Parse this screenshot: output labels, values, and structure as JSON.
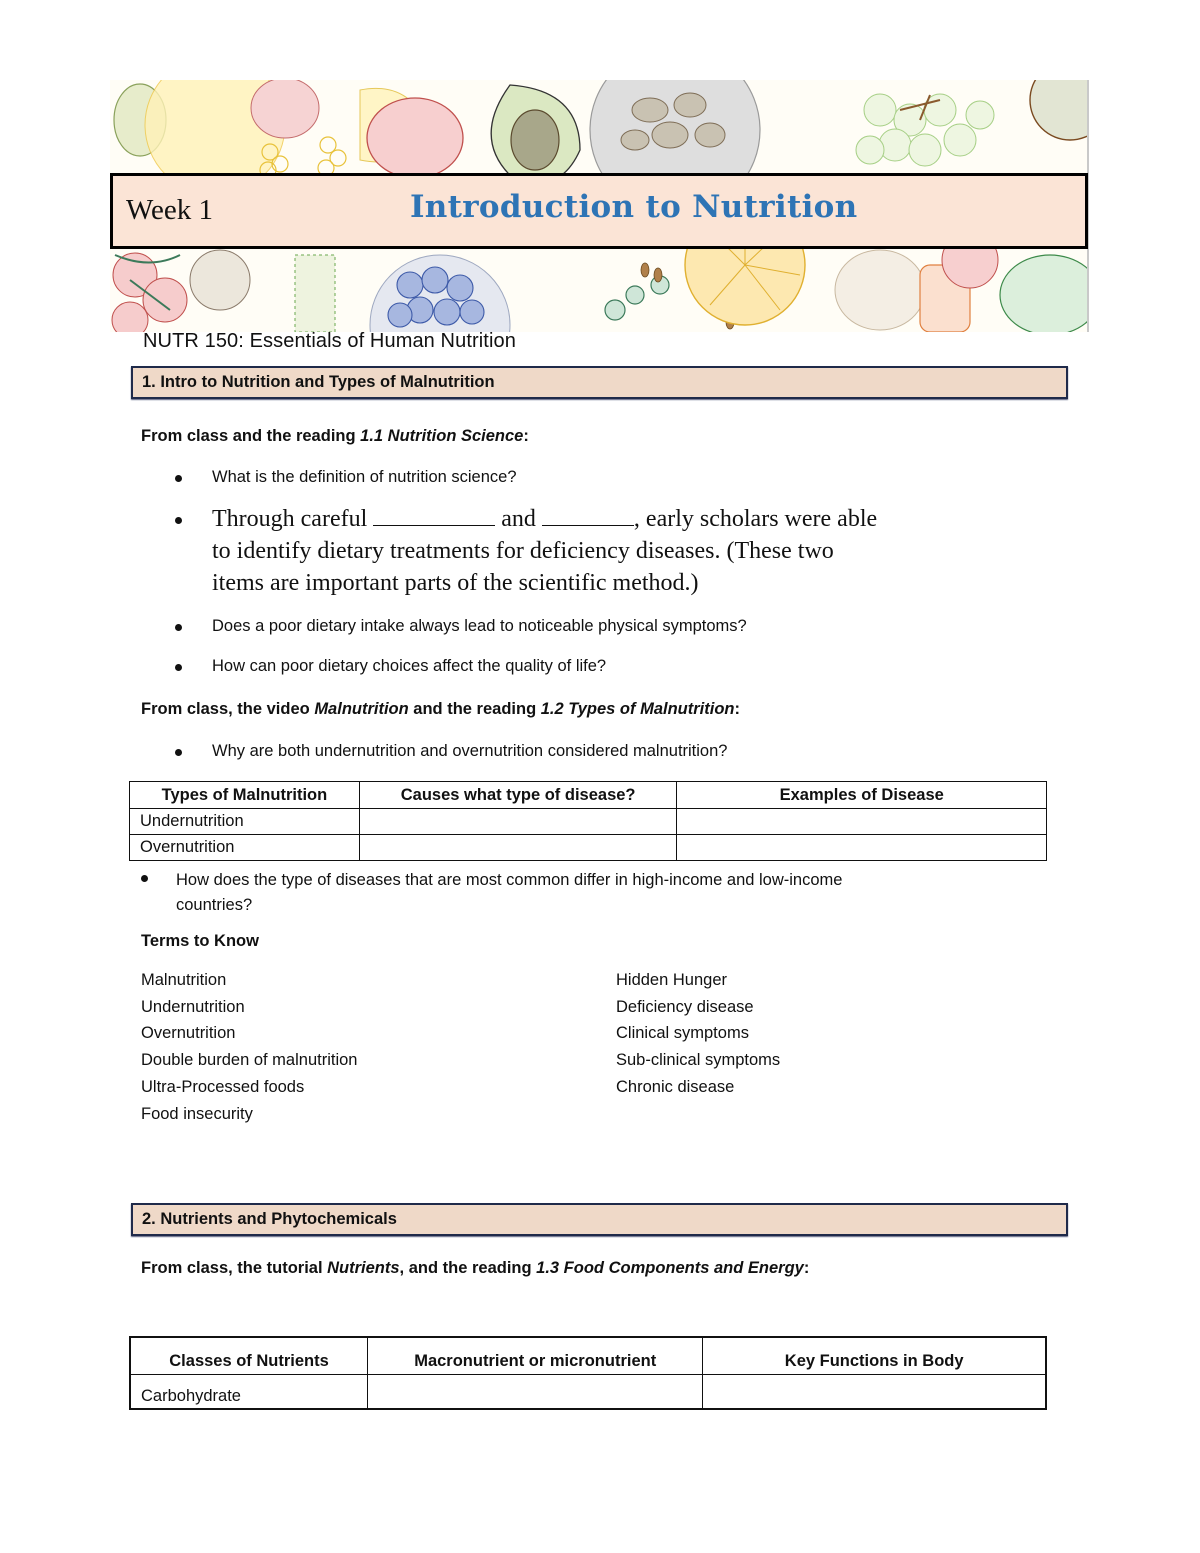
{
  "banner": {
    "illustration": "hand-drawn fruits and vegetables",
    "week_label": "Week 1",
    "title": "Introduction to Nutrition",
    "colors": {
      "title_box_bg": "#fbe4d6",
      "title_text": "#2e74b5",
      "border": "#000000"
    }
  },
  "course_title": "NUTR 150: Essentials of Human Nutrition",
  "section1": {
    "header": "1. Intro to Nutrition and Types of Malnutrition",
    "lead1": {
      "prefix": "From class and the reading ",
      "italic": "1.1 Nutrition Science",
      "suffix": ":"
    },
    "bullets_a": [
      "What is the definition of nutrition science?"
    ],
    "fill_in": {
      "part1": "Through careful ",
      "blank1": "___________",
      "part2": " and ",
      "blank2": "_________",
      "part3": ", early scholars were able",
      "line2": "to identify dietary treatments for deficiency diseases. (These two",
      "line3": "items are important parts of the scientific method.)"
    },
    "bullets_b": [
      "Does a poor dietary intake always lead to noticeable physical symptoms?",
      "How can poor dietary choices affect the quality of life?"
    ],
    "lead2": {
      "prefix": "From class, the video ",
      "italic1": "Malnutrition",
      "middle": " and the reading ",
      "italic2": "1.2 Types of Malnutrition",
      "suffix": ":"
    },
    "bullets_c": [
      "Why are both undernutrition and overnutrition considered malnutrition?"
    ],
    "table": {
      "headers": [
        "Types of Malnutrition",
        "Causes what type of disease?",
        "Examples of Disease"
      ],
      "rows": [
        [
          "Undernutrition",
          "",
          ""
        ],
        [
          "Overnutrition",
          "",
          ""
        ]
      ]
    },
    "bullets_d": [
      "How does the type of diseases that are most common differ in high-income and low-income",
      "countries?"
    ],
    "terms_heading": "Terms to Know",
    "terms_left": [
      "Malnutrition",
      "Undernutrition",
      "Overnutrition",
      "Double burden of malnutrition",
      "Ultra-Processed foods",
      "Food insecurity"
    ],
    "terms_right": [
      "Hidden Hunger",
      "Deficiency disease",
      "Clinical symptoms",
      "Sub-clinical symptoms",
      "Chronic disease"
    ]
  },
  "section2": {
    "header": "2. Nutrients and Phytochemicals",
    "lead": {
      "prefix": "From class, the tutorial ",
      "italic1": "Nutrients",
      "middle": ", and the reading ",
      "italic2": "1.3 Food Components and Energy",
      "suffix": ":"
    },
    "table": {
      "headers": [
        "Classes of Nutrients",
        "Macronutrient or micronutrient",
        "Key Functions in Body"
      ],
      "rows": [
        [
          "Carbohydrate",
          "",
          ""
        ]
      ]
    }
  }
}
